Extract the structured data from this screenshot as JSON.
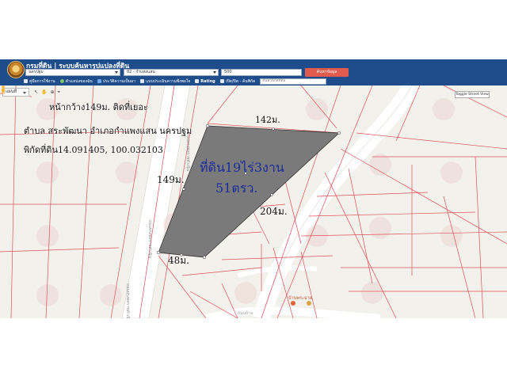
{
  "header": {
    "title": "กรมที่ดิน | ระบบค้นหารูปแปลงที่ดิน",
    "province_select": "นครปฐม",
    "amphoe_select": "02 - กำแพงแสน",
    "parcel_input": "500",
    "search_button": "ค้นหาข้อมูล",
    "coord_placeholder": "ค้นหาพิกัดที่ดิน"
  },
  "menu": {
    "items": [
      {
        "label": "คู่มือการใช้งาน",
        "icon": "book-icon"
      },
      {
        "label": "ตำแหน่งของฉัน",
        "icon": "location-icon"
      },
      {
        "label": "ประวัติความเป็นมา",
        "icon": "history-icon"
      },
      {
        "label": "แบบประเมินความพึงพอใจ",
        "icon": "survey-icon"
      },
      {
        "label": "Rating",
        "icon": "rating-icon"
      },
      {
        "label": "เปิด/ปิด - ค้นพิกัด",
        "icon": "checkbox-icon"
      }
    ]
  },
  "map": {
    "map_type": "แผนที่",
    "tools": [
      "↖",
      "✋",
      "⊕",
      "⌖"
    ],
    "toggle_street_view": "Toggle Street View",
    "zoom_in": "+",
    "zoom_out": "−",
    "place_label": "บ้านพระฉาย",
    "road_label": "ถนนบ้าน",
    "parcel_fill": "#7a7a7a",
    "boundary_color": "#e0505a",
    "edge_labels": {
      "top": "142ม.",
      "left": "149ม.",
      "right": "204ม.",
      "bottom": "48ม."
    }
  },
  "annotations": {
    "line1": "หน้ากว้าง149ม. ติดที่เยอะ",
    "line2": "ตำบล สระพัฒนา อำเภอกำแพงแสน นครปฐม",
    "line3": "พิกัดที่ดิน14.091405, 100.032103",
    "area_line1": "ที่ดิน19ไร่3งาน",
    "area_line2": "51ตรว."
  }
}
